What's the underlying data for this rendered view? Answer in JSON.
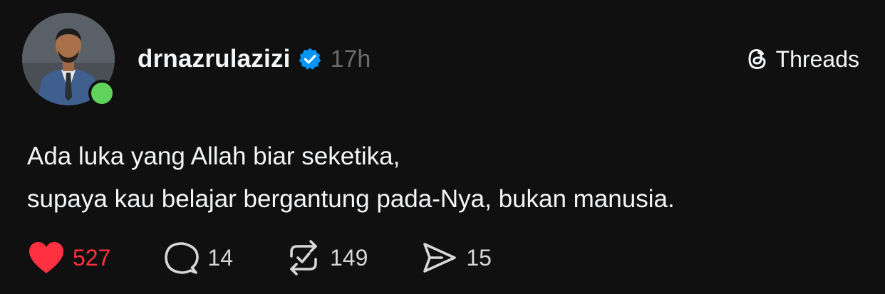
{
  "post": {
    "username": "drnazrulazizi",
    "timestamp": "17h",
    "brand_label": "Threads",
    "lines": [
      "Ada luka yang Allah biar seketika,",
      "supaya kau belajar bergantung pada-Nya, bukan manusia."
    ]
  },
  "actions": {
    "like_count": "527",
    "reply_count": "14",
    "repost_count": "149",
    "share_count": "15"
  },
  "colors": {
    "background": "#101010",
    "text": "#f3f5f7",
    "muted": "#6b6b6b",
    "like": "#ff3040",
    "verified": "#0095f6",
    "online": "#5fd35a"
  },
  "icons": {
    "verified": "verified-badge-icon",
    "brand": "threads-logo-icon",
    "like": "heart-icon",
    "reply": "comment-icon",
    "repost": "repost-icon",
    "share": "send-icon"
  }
}
